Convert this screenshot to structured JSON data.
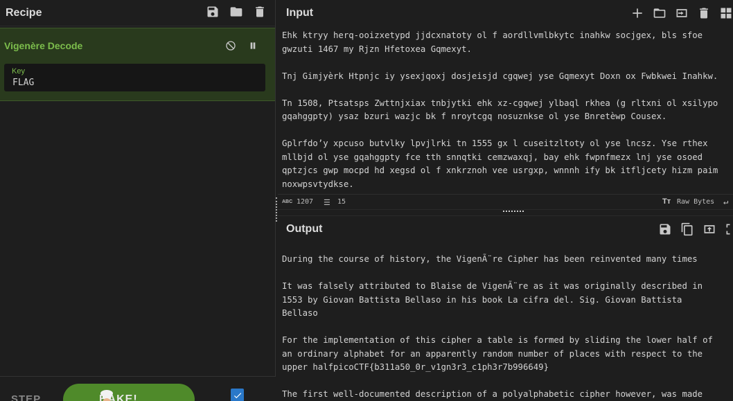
{
  "recipe": {
    "title": "Recipe",
    "header_icons": [
      "save-icon",
      "folder-icon",
      "trash-icon"
    ],
    "operation": {
      "name": "Vigenère Decode",
      "controls": [
        "disable-icon",
        "pause-icon"
      ],
      "key_label": "Key",
      "key_value": "FLAG"
    },
    "step_label": "STEP",
    "bake_label": "BAKE!",
    "autobake_checked": true
  },
  "input": {
    "title": "Input",
    "header_icons": [
      "add-icon",
      "open-folder-icon",
      "import-icon",
      "trash-icon",
      "layout-icon"
    ],
    "text": "Ehk ktryy herq-ooizxetypd jjdcxnatoty ol f aordllvmlbkytc inahkw socjgex, bls sfoe\ngwzuti 1467 my Rjzn Hfetoxea Gqmexyt.\n\nTnj Gimjyèrk Htpnjc iy ysexjqoxj dosjeisjd cgqwej yse Gqmexyt Doxn ox Fwbkwei Inahkw.\n\nTn 1508, Ptsatsps Zwttnjxiax tnbjytki ehk xz-cgqwej ylbaql rkhea (g rltxni ol xsilypo\ngqahggpty) ysaz bzuri wazjc bk f nroytcgq nosuznkse ol yse Bnretèwp Cousex.\n\nGplrfdo’y xpcuso butvlky lpvjlrki tn 1555 gx l cuseitzltoty ol yse lncsz. Yse rthex\nmllbjd ol yse gqahggpty fce tth snnqtki cemzwaxqj, bay ehk fwpnfmezx lnj yse osoed\nqptzjcs gwp mocpd hd xegsd ol f xnkrznoh vee usrgxp, wnnnh ify bk itfljcety hizm paim\nnoxwpsvtydkse.",
    "status": {
      "char_icon_label": "ABC",
      "char_count": "1207",
      "line_count": "15",
      "raw_bytes_label": "Raw Bytes",
      "raw_bytes_icon_label": "Tт"
    }
  },
  "output": {
    "title": "Output",
    "header_icons": [
      "save-icon",
      "copy-icon",
      "replace-input-icon",
      "maximize-icon"
    ],
    "text": "During the course of history, the VigenÃ¨re Cipher has been reinvented many times\n\nIt was falsely attributed to Blaise de VigenÃ¨re as it was originally described in\n1553 by Giovan Battista Bellaso in his book La cifra del. Sig. Giovan Battista\nBellaso\n\nFor the implementation of this cipher a table is formed by sliding the lower half of\nan ordinary alphabet for an apparently random number of places with respect to the\nupper halfpicoCTF{b311a50_0r_v1gn3r3_c1ph3r7b996649}\n\nThe first well-documented description of a polyalphabetic cipher however, was made"
  },
  "colors": {
    "background": "#1e1e1e",
    "operation_bg": "#293a1d",
    "operation_accent": "#7cbd4c",
    "bake_button": "#4f8a2a",
    "checkbox": "#2a78c9"
  }
}
